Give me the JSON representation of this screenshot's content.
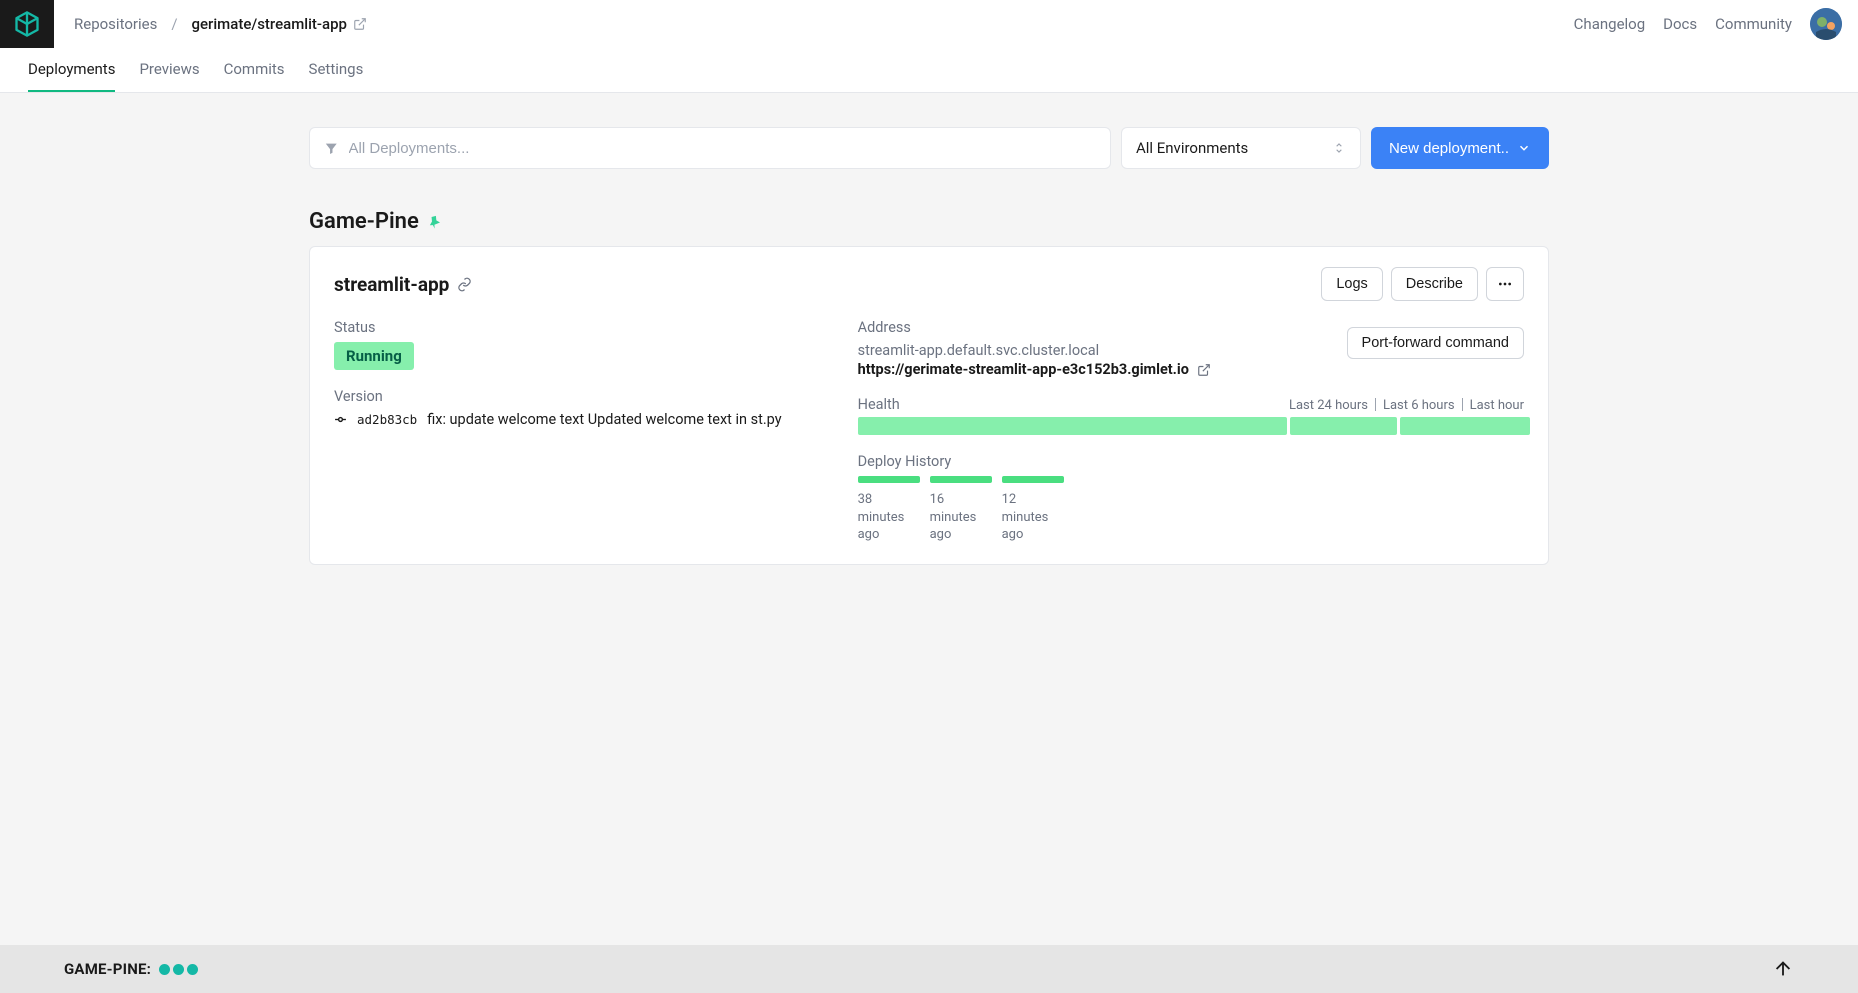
{
  "breadcrumb": {
    "root": "Repositories",
    "current": "gerimate/streamlit-app"
  },
  "header_links": {
    "changelog": "Changelog",
    "docs": "Docs",
    "community": "Community"
  },
  "tabs": {
    "deployments": "Deployments",
    "previews": "Previews",
    "commits": "Commits",
    "settings": "Settings"
  },
  "filter": {
    "placeholder": "All Deployments...",
    "env_label": "All Environments",
    "new_btn": "New deployment.."
  },
  "cluster": {
    "name": "Game-Pine"
  },
  "app": {
    "name": "streamlit-app",
    "actions": {
      "logs": "Logs",
      "describe": "Describe",
      "port_forward": "Port-forward command"
    },
    "status_label": "Status",
    "status_value": "Running",
    "version_label": "Version",
    "commit_hash": "ad2b83cb",
    "commit_message": "fix: update welcome text Updated welcome text in st.py",
    "address_label": "Address",
    "address_internal": "streamlit-app.default.svc.cluster.local",
    "address_public": "https://gerimate-streamlit-app-e3c152b3.gimlet.io",
    "health_label": "Health",
    "health_periods": {
      "p24": "Last 24 hours",
      "p6": "Last 6 hours",
      "p1": "Last hour"
    },
    "deploy_history_label": "Deploy History",
    "deploy_history": [
      {
        "line1": "38",
        "line2": "minutes",
        "line3": "ago"
      },
      {
        "line1": "16",
        "line2": "minutes",
        "line3": "ago"
      },
      {
        "line1": "12",
        "line2": "minutes",
        "line3": "ago"
      }
    ]
  },
  "footer": {
    "label": "GAME-PINE:"
  }
}
